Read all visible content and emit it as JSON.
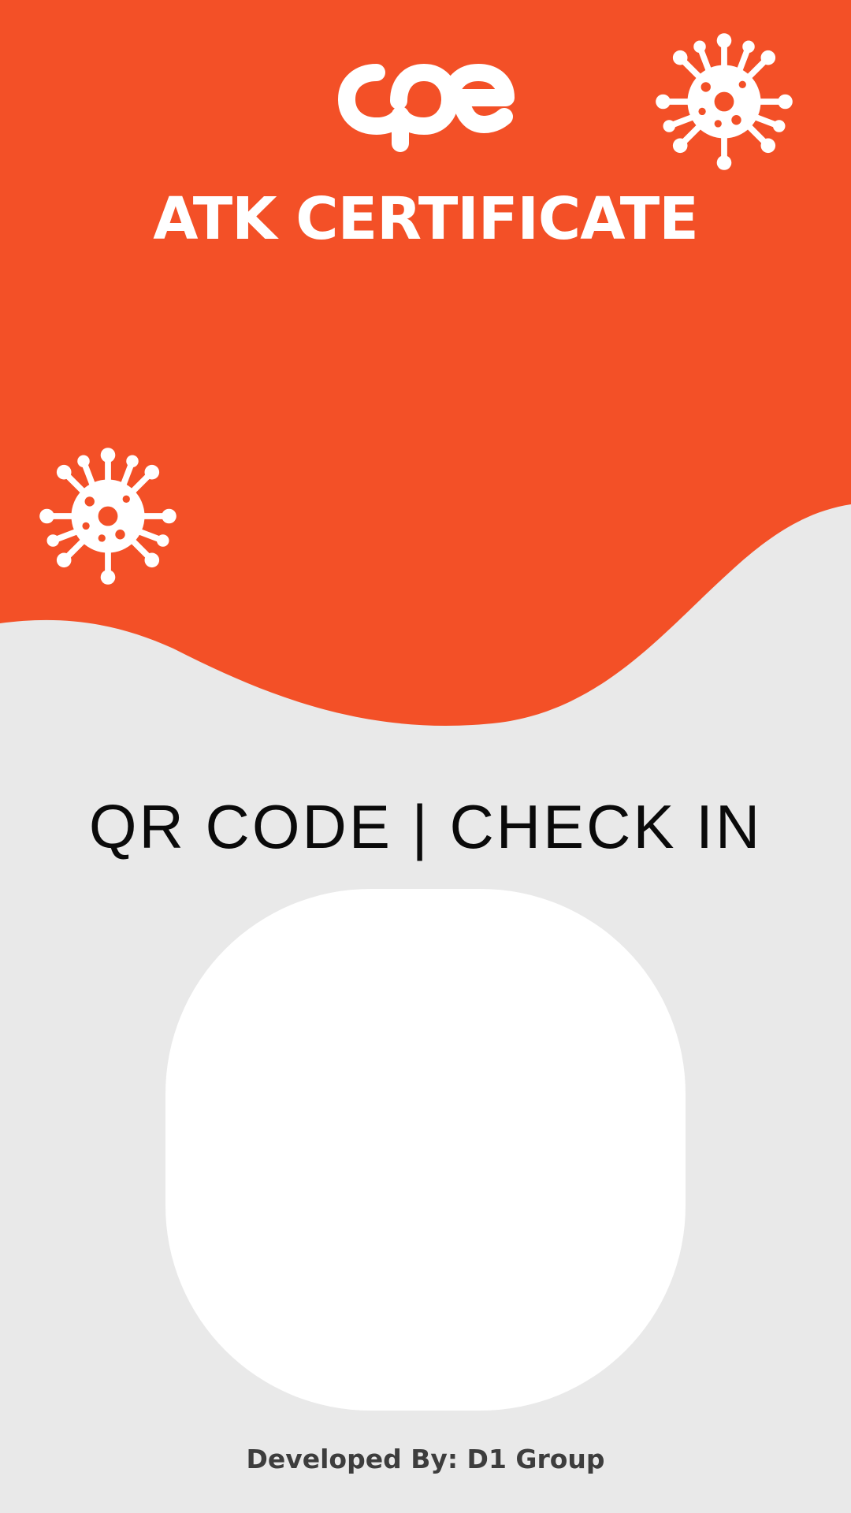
{
  "colors": {
    "brand_orange": "#f35027",
    "background_gray": "#e9e9e9",
    "card_white": "#ffffff",
    "heading_text": "#0a0a0a",
    "footer_text": "#3d3d3d"
  },
  "header": {
    "logo_text": "cpe",
    "title": "ATK CERTIFICATE",
    "decorations": [
      "virus-icon",
      "virus-icon"
    ]
  },
  "main": {
    "qr_heading": "QR CODE | CHECK IN",
    "qr_card_icon": "qr-code-placeholder"
  },
  "footer": {
    "credit": "Developed By: D1 Group"
  }
}
